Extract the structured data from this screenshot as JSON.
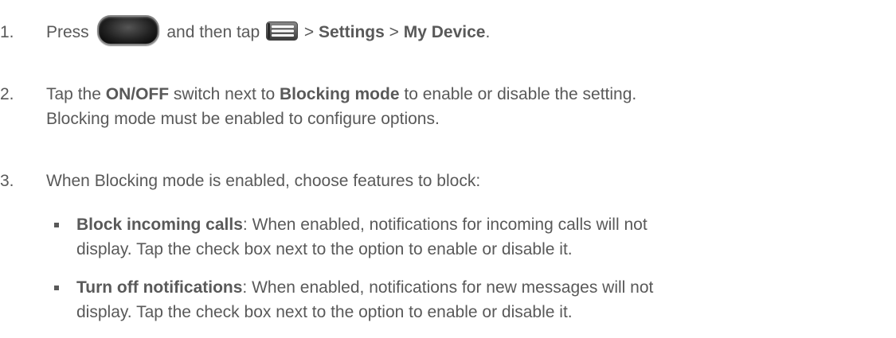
{
  "steps": [
    {
      "num": "1.",
      "pre": "Press",
      "home_icon": "home-key-icon",
      "mid": "and then tap",
      "menu_icon": "menu-key-icon",
      "sep1": ">",
      "settings": "Settings",
      "sep2": ">",
      "my_device": "My Device",
      "end": "."
    },
    {
      "num": "2.",
      "line1_pre": "Tap the",
      "on_off": "ON/OFF",
      "line1_mid": "switch next to",
      "blocking_mode": "Blocking mode",
      "line1_end": "to enable or disable the setting.",
      "line2": "Blocking mode must be enabled to configure options."
    },
    {
      "num": "3.",
      "text": "When Blocking mode is enabled, choose features to block:"
    }
  ],
  "bullets": [
    {
      "title": "Block incoming calls",
      "line1": ": When enabled, notifications for incoming calls will not",
      "line2": "display. Tap the check box next to the option to enable or disable it."
    },
    {
      "title": "Turn off notifications",
      "line1": ": When enabled, notifications for new messages will not",
      "line2": "display. Tap the check box next to the option to enable or disable it."
    }
  ]
}
